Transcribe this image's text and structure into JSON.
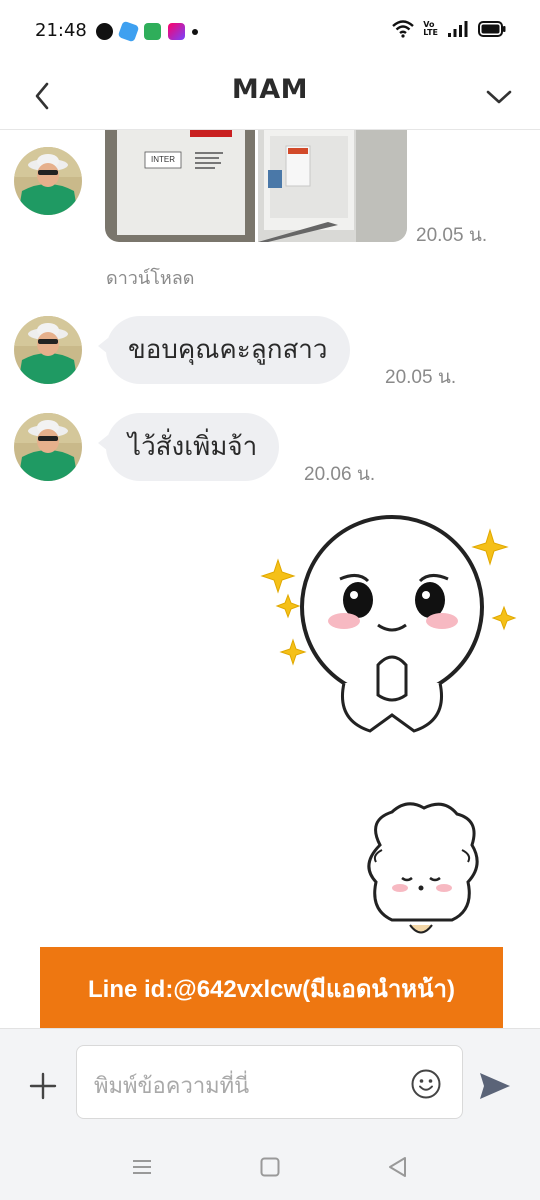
{
  "status_bar": {
    "time": "21:48",
    "left_icons": [
      "line-app-icon",
      "app-icon-blue",
      "app-icon-green",
      "app-icon-purple",
      "notification-dot-icon"
    ],
    "right_icons": [
      "wifi-icon",
      "volte-icon",
      "signal-icon",
      "battery-icon"
    ],
    "volte_text": "Vo LTE"
  },
  "header": {
    "title": "MAM",
    "back_icon": "chevron-left-icon",
    "dropdown_icon": "chevron-down-icon"
  },
  "messages": [
    {
      "type": "photos",
      "photo_label": "INTER",
      "time": "20.05 น.",
      "download_label": "ดาวน์โหลด"
    },
    {
      "type": "text",
      "text": "ขอบคุณคะลูกสาว",
      "time": "20.05 น."
    },
    {
      "type": "text",
      "text": "ไว้สั่งเพิ่มจ้า",
      "time": "20.06 น."
    },
    {
      "type": "sticker",
      "sticker": "cony-pleading-sticker"
    },
    {
      "type": "sticker",
      "sticker": "sheep-bowing-sticker"
    }
  ],
  "promo_banner": {
    "text": "Line id:@642vxlcw(มีแอดนำหน้า)",
    "color": "#ee7711"
  },
  "input": {
    "placeholder": "พิมพ์ข้อความที่นี่",
    "add_icon": "plus-icon",
    "emoji_icon": "smiley-icon",
    "send_icon": "send-icon"
  },
  "nav_bar": {
    "icons": [
      "recent-apps-icon",
      "home-icon",
      "back-triangle-icon"
    ]
  },
  "colors": {
    "bubble": "#eeeff2",
    "timestamp": "#8a8a8a",
    "banner": "#ee7711"
  }
}
